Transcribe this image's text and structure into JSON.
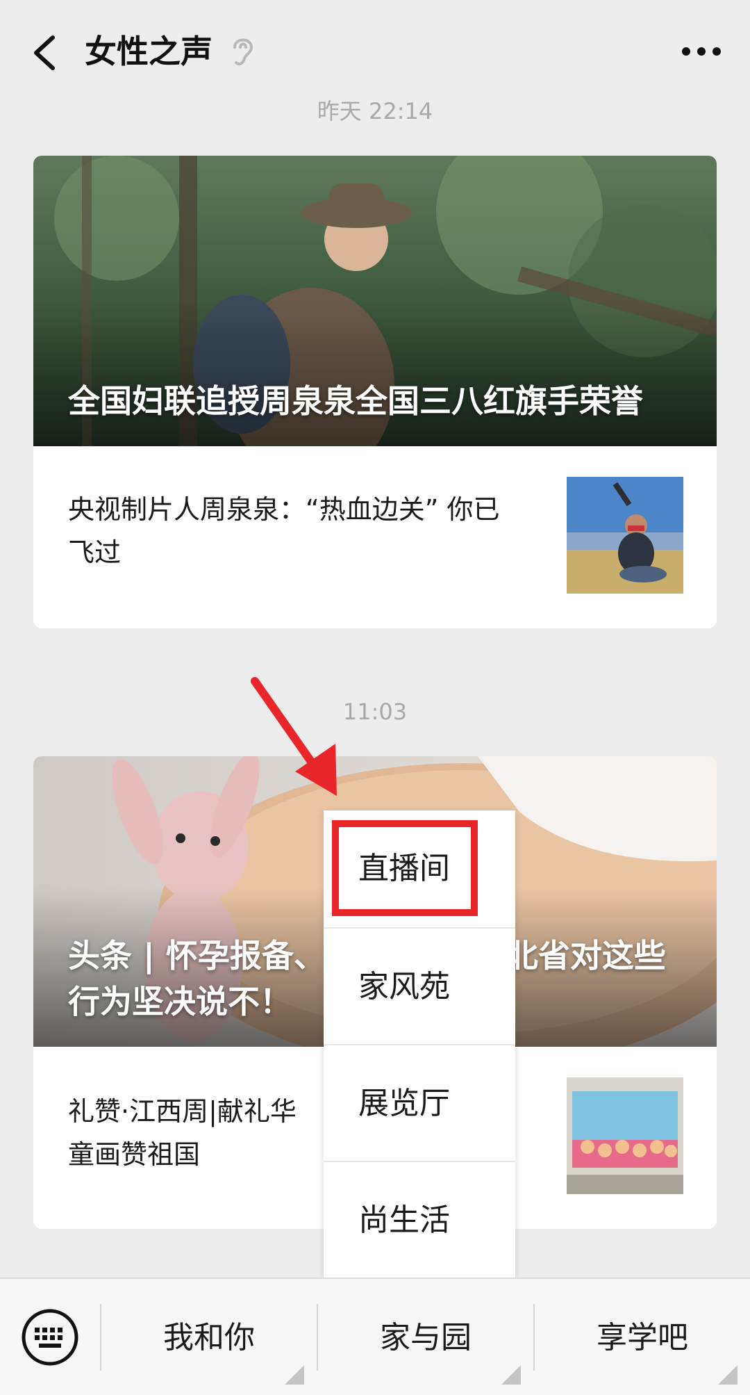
{
  "header": {
    "title": "女性之声"
  },
  "feed": {
    "messages": [
      {
        "time": "昨天 22:14",
        "cover_title": "全国妇联追授周泉泉全国三八红旗手荣誉",
        "sub_article": "央视制片人周泉泉：“热血边关” 你已飞过"
      },
      {
        "time": "11:03",
        "cover_title": "头条 | 怀孕报备、…北省对这些行为坚决说不！",
        "cover_title_left_line1": "头条 | 怀孕报备、",
        "cover_title_right_line1": "北省对这些",
        "cover_title_line2": "行为坚决说不！",
        "sub_article_line1": "礼赞·江西周|献礼华",
        "sub_article_line2": "童画赞祖国"
      }
    ]
  },
  "popup_menu": {
    "items": [
      "直播间",
      "家风苑",
      "展览厅",
      "尚生活"
    ],
    "highlighted_index": 0
  },
  "bottom_menu": {
    "items": [
      "我和你",
      "家与园",
      "享学吧"
    ]
  },
  "colors": {
    "highlight": "#e8262a",
    "background": "#ededed"
  }
}
